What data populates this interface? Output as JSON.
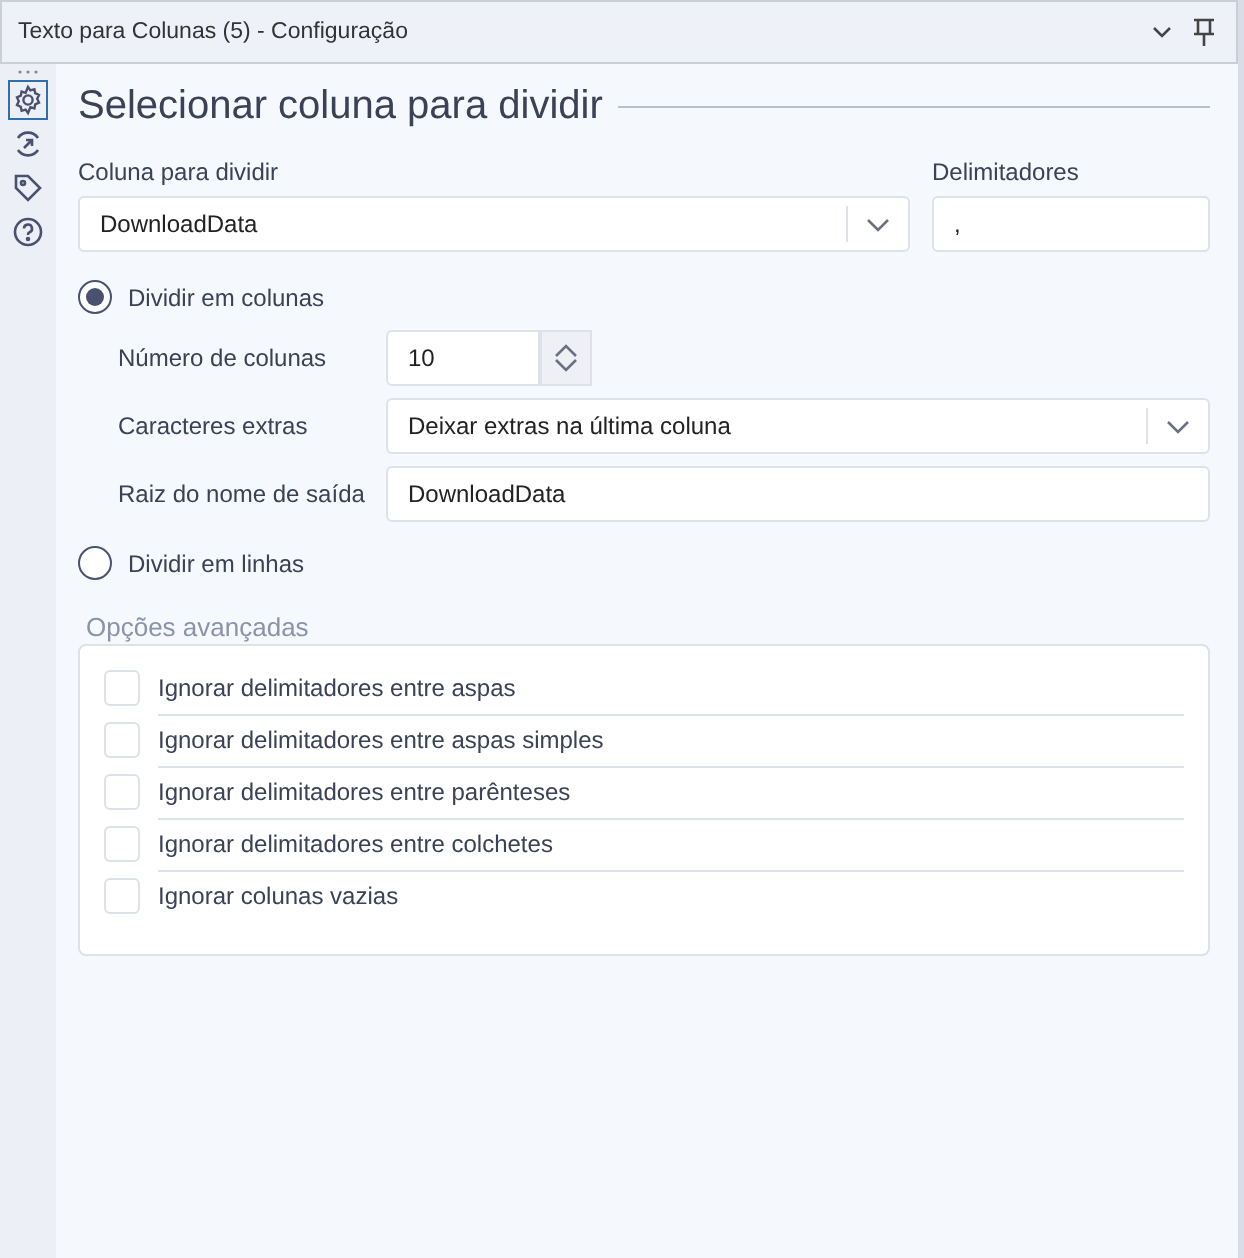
{
  "window": {
    "title": "Texto para Colunas (5) - Configuração"
  },
  "sidebar": {
    "items": [
      {
        "kind": "gear",
        "selected": true
      },
      {
        "kind": "connect",
        "selected": false
      },
      {
        "kind": "tag",
        "selected": false
      },
      {
        "kind": "help",
        "selected": false
      }
    ]
  },
  "heading": "Selecionar coluna para dividir",
  "column_field": {
    "label": "Coluna para dividir",
    "value": "DownloadData"
  },
  "delimiters_field": {
    "label": "Delimitadores",
    "value": ","
  },
  "modes": [
    {
      "label": "Dividir em colunas",
      "selected": true
    },
    {
      "label": "Dividir em linhas",
      "selected": false
    }
  ],
  "column_options": {
    "count": {
      "label": "Número de colunas",
      "value": "10"
    },
    "extra": {
      "label": "Caracteres extras",
      "value": "Deixar extras na última coluna"
    },
    "root": {
      "label": "Raiz do nome de saída",
      "value": "DownloadData"
    }
  },
  "advanced": {
    "title": "Opções avançadas",
    "options": [
      {
        "label": "Ignorar delimitadores entre aspas",
        "checked": false
      },
      {
        "label": "Ignorar delimitadores entre aspas simples",
        "checked": false
      },
      {
        "label": "Ignorar delimitadores entre parênteses",
        "checked": false
      },
      {
        "label": "Ignorar delimitadores entre colchetes",
        "checked": false
      },
      {
        "label": "Ignorar colunas vazias",
        "checked": false
      }
    ]
  }
}
